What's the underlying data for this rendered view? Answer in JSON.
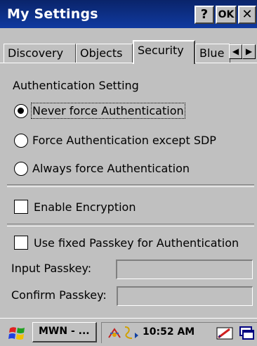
{
  "window": {
    "title": "My Settings",
    "help_label": "?",
    "ok_label": "OK",
    "close_label": "✕"
  },
  "tabs": [
    {
      "label": "Discovery",
      "active": false
    },
    {
      "label": "Objects",
      "active": false
    },
    {
      "label": "Security",
      "active": true
    },
    {
      "label": "Blue",
      "active": false
    }
  ],
  "tab_scroll": {
    "left": "◀",
    "right": "▶"
  },
  "authentication": {
    "heading": "Authentication Setting",
    "options": [
      {
        "label": "Never force Authentication",
        "selected": true
      },
      {
        "label": "Force Authentication except SDP",
        "selected": false
      },
      {
        "label": "Always force Authentication",
        "selected": false
      }
    ]
  },
  "encryption": {
    "label": "Enable Encryption",
    "checked": false
  },
  "passkey": {
    "label": "Use fixed Passkey for Authentication",
    "checked": false,
    "input_label": "Input Passkey:",
    "input_value": "",
    "confirm_label": "Confirm Passkey:",
    "confirm_value": ""
  },
  "taskbar": {
    "start_icon": "windows-flag-icon",
    "task_label": "MWN - ...",
    "clock": "10:52 AM",
    "tray_icons": [
      "bluetooth-icon",
      "network-icon",
      "input-panel-icon",
      "desktop-icon"
    ]
  },
  "colors": {
    "titlebar": "#0a246a",
    "face": "#c0c0c0"
  }
}
